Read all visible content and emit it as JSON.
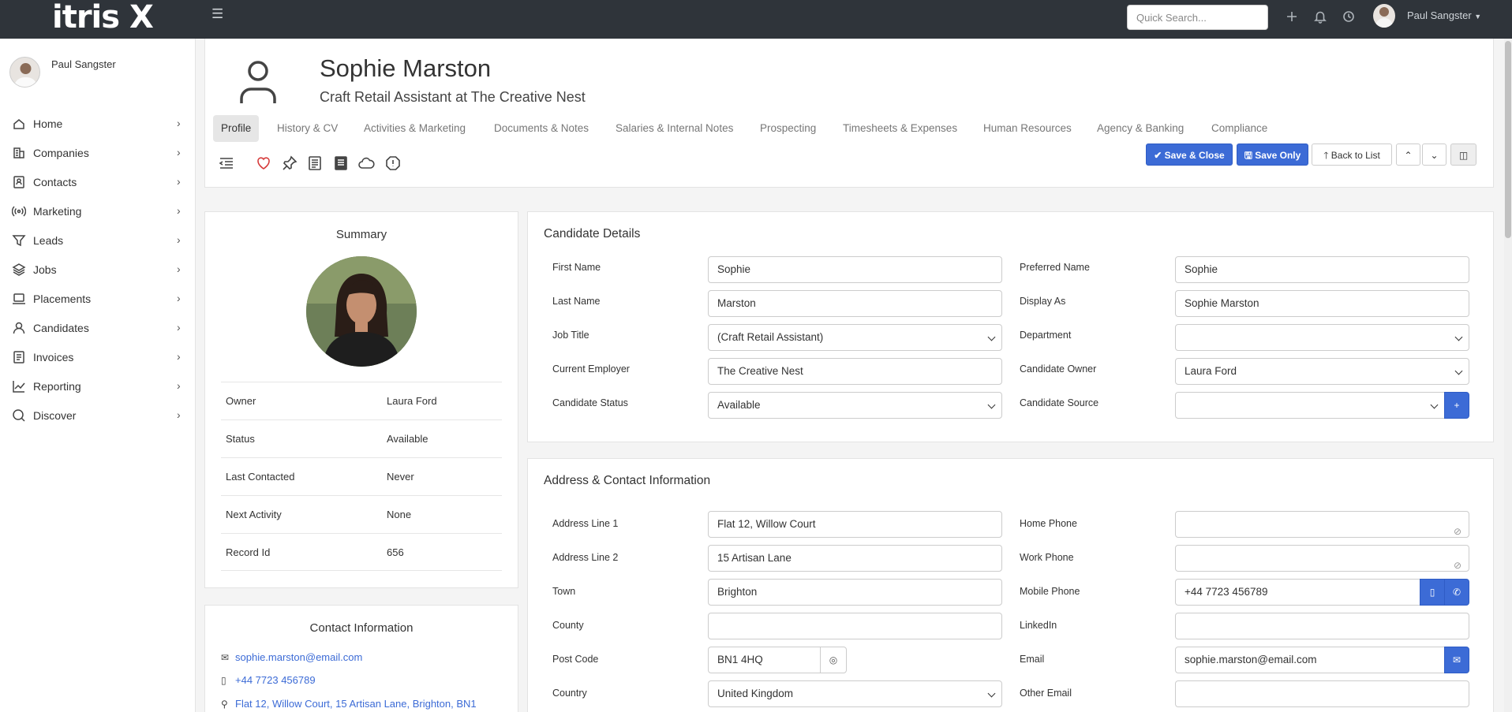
{
  "topbar": {
    "logo": "itris X",
    "search_placeholder": "Quick Search...",
    "user_name": "Paul Sangster",
    "icons": [
      "plus-icon",
      "bell-icon",
      "history-icon"
    ]
  },
  "sidebar": {
    "user_name": "Paul Sangster",
    "items": [
      {
        "label": "Home",
        "icon": "home-icon"
      },
      {
        "label": "Companies",
        "icon": "building-icon"
      },
      {
        "label": "Contacts",
        "icon": "contact-book-icon"
      },
      {
        "label": "Marketing",
        "icon": "broadcast-icon"
      },
      {
        "label": "Leads",
        "icon": "funnel-icon"
      },
      {
        "label": "Jobs",
        "icon": "layers-icon"
      },
      {
        "label": "Placements",
        "icon": "laptop-icon"
      },
      {
        "label": "Candidates",
        "icon": "person-icon"
      },
      {
        "label": "Invoices",
        "icon": "invoice-icon"
      },
      {
        "label": "Reporting",
        "icon": "chart-line-icon"
      },
      {
        "label": "Discover",
        "icon": "circle-search-icon"
      }
    ]
  },
  "header": {
    "name": "Sophie Marston",
    "subtitle": "Craft Retail Assistant at The Creative Nest",
    "tabs": [
      "Profile",
      "History & CV",
      "Activities & Marketing",
      "Documents & Notes",
      "Salaries & Internal Notes",
      "Prospecting",
      "Timesheets & Expenses",
      "Human Resources",
      "Agency & Banking",
      "Compliance"
    ],
    "active_tab": "Profile",
    "buttons": {
      "save_close": "Save & Close",
      "save_only": "Save Only",
      "back": "Back to List"
    }
  },
  "summary": {
    "title": "Summary",
    "rows": [
      {
        "k": "Owner",
        "v": "Laura Ford"
      },
      {
        "k": "Status",
        "v": "Available"
      },
      {
        "k": "Last Contacted",
        "v": "Never"
      },
      {
        "k": "Next Activity",
        "v": "None"
      },
      {
        "k": "Record Id",
        "v": "656"
      }
    ]
  },
  "contact_info": {
    "title": "Contact Information",
    "email": "sophie.marston@email.com",
    "phone": "+44 7723 456789",
    "address": "Flat 12, Willow Court, 15 Artisan Lane, Brighton, BN1"
  },
  "candidate_details": {
    "title": "Candidate Details",
    "first_name_label": "First Name",
    "first_name": "Sophie",
    "preferred_name_label": "Preferred Name",
    "preferred_name": "Sophie",
    "last_name_label": "Last Name",
    "last_name": "Marston",
    "display_as_label": "Display As",
    "display_as": "Sophie Marston",
    "job_title_label": "Job Title",
    "job_title": "(Craft Retail Assistant)",
    "department_label": "Department",
    "department": "",
    "employer_label": "Current Employer",
    "employer": "The Creative Nest",
    "owner_label": "Candidate Owner",
    "owner": "Laura Ford",
    "status_label": "Candidate Status",
    "status": "Available",
    "source_label": "Candidate Source",
    "source": ""
  },
  "address": {
    "title": "Address & Contact Information",
    "line1_label": "Address Line 1",
    "line1": "Flat 12, Willow Court",
    "line2_label": "Address Line 2",
    "line2": "15 Artisan Lane",
    "town_label": "Town",
    "town": "Brighton",
    "county_label": "County",
    "county": "",
    "postcode_label": "Post Code",
    "postcode": "BN1 4HQ",
    "country_label": "Country",
    "country": "United Kingdom",
    "home_phone_label": "Home Phone",
    "home_phone": "",
    "work_phone_label": "Work Phone",
    "work_phone": "",
    "mobile_label": "Mobile Phone",
    "mobile": "+44 7723 456789",
    "linkedin_label": "LinkedIn",
    "linkedin": "",
    "email_label": "Email",
    "email": "sophie.marston@email.com",
    "other_email_label": "Other Email",
    "other_email": ""
  },
  "colors": {
    "topbar": "#2f343a",
    "primary": "#3c6bd6",
    "link": "#3c6bd6"
  }
}
